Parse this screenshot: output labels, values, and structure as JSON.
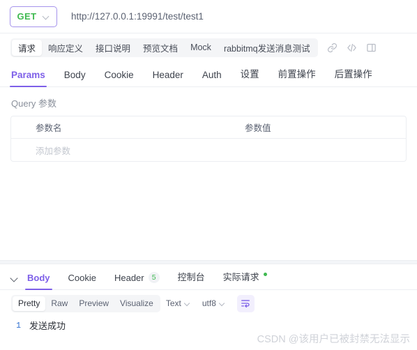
{
  "request_bar": {
    "method": "GET",
    "method_dropdown_icon": "chevron-down-icon",
    "url": "http://127.0.0.1:19991/test/test1"
  },
  "top_tabs": {
    "items": [
      {
        "label": "请求",
        "active": true
      },
      {
        "label": "响应定义",
        "active": false
      },
      {
        "label": "接口说明",
        "active": false
      },
      {
        "label": "预览文档",
        "active": false
      },
      {
        "label": "Mock",
        "active": false
      },
      {
        "label": "rabbitmq发送消息测试",
        "active": false
      }
    ],
    "icons": [
      {
        "name": "link-icon"
      },
      {
        "name": "code-icon"
      },
      {
        "name": "panel-layout-icon"
      }
    ]
  },
  "sub_tabs": {
    "items": [
      {
        "label": "Params",
        "active": true
      },
      {
        "label": "Body",
        "active": false
      },
      {
        "label": "Cookie",
        "active": false
      },
      {
        "label": "Header",
        "active": false
      },
      {
        "label": "Auth",
        "active": false
      },
      {
        "label": "设置",
        "active": false
      },
      {
        "label": "前置操作",
        "active": false
      },
      {
        "label": "后置操作",
        "active": false
      }
    ]
  },
  "params_section": {
    "title": "Query 参数",
    "columns": [
      "参数名",
      "参数值"
    ],
    "rows": [
      {
        "name": "添加参数",
        "value": "",
        "placeholder": true
      }
    ]
  },
  "response_panel": {
    "collapse_icon": "chevron-down-icon",
    "tabs": [
      {
        "label": "Body",
        "active": true,
        "badge": null,
        "dot": false
      },
      {
        "label": "Cookie",
        "active": false,
        "badge": null,
        "dot": false
      },
      {
        "label": "Header",
        "active": false,
        "badge": "5",
        "dot": false
      },
      {
        "label": "控制台",
        "active": false,
        "badge": null,
        "dot": false
      },
      {
        "label": "实际请求",
        "active": false,
        "badge": null,
        "dot": true
      }
    ],
    "toolbar": {
      "view_modes": [
        {
          "label": "Pretty",
          "active": true
        },
        {
          "label": "Raw",
          "active": false
        },
        {
          "label": "Preview",
          "active": false
        },
        {
          "label": "Visualize",
          "active": false
        }
      ],
      "format_select": "Text",
      "encoding_select": "utf8",
      "wrap_button_icon": "wrap-text-icon"
    },
    "body": {
      "lines": [
        {
          "number": "1",
          "text": "发送成功"
        }
      ]
    }
  },
  "watermark": {
    "text": "CSDN @该用户已被封禁无法显示"
  },
  "colors": {
    "accent_purple": "#7d5fe8",
    "method_green": "#3fb950",
    "border": "#eceef2",
    "muted_text": "#8b919c"
  }
}
